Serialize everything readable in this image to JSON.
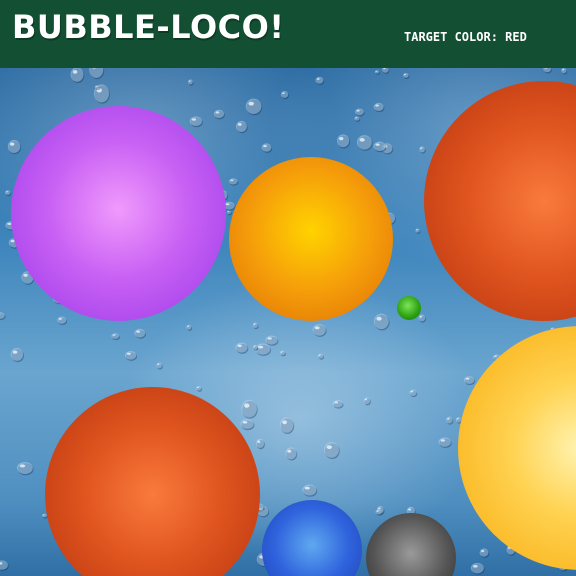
{
  "header": {
    "title": "BUBBLE-LOCO!",
    "target_label": "TARGET COLOR:",
    "target_value": "RED"
  },
  "bubbles": [
    {
      "color": "purple",
      "hex": "#c860f4"
    },
    {
      "color": "orange",
      "hex": "#f59d0a"
    },
    {
      "color": "red",
      "hex": "#e0551f"
    },
    {
      "color": "green",
      "hex": "#2fa512"
    },
    {
      "color": "yellow",
      "hex": "#ffd250"
    },
    {
      "color": "red",
      "hex": "#e0551f"
    },
    {
      "color": "blue",
      "hex": "#2f63dd"
    },
    {
      "color": "grey",
      "hex": "#555555"
    }
  ],
  "colors": {
    "header_bg": "#134f32",
    "title_text": "#ffffff",
    "background": "rain-on-glass-blue"
  }
}
